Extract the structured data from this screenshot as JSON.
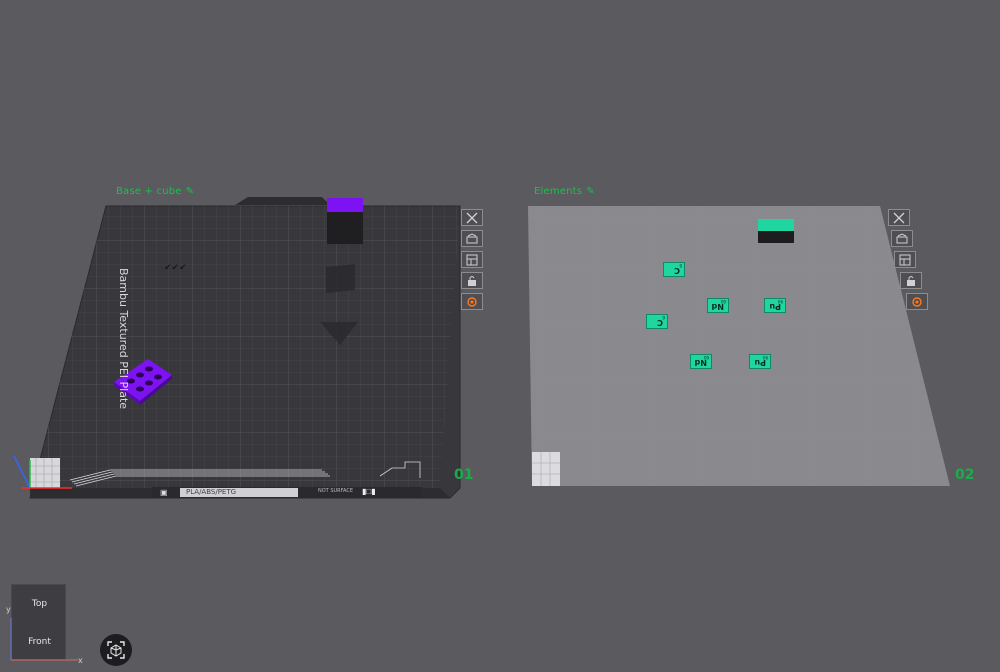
{
  "colors": {
    "background": "#5a5a5f",
    "accent_green": "#19c24a",
    "filament_purple": "#7d12f2",
    "filament_teal": "#1fd6a0"
  },
  "plates": [
    {
      "title": "Base + cube",
      "number": "01",
      "bed_label": "Bambu Textured PEI Plate",
      "filament_label": "PLA/ABS/PETG",
      "surface_label": "NOT SURFACE",
      "selected": true,
      "tools": [
        "close-icon",
        "auto-orient-icon",
        "arrange-icon",
        "lock-icon",
        "settings-icon"
      ]
    },
    {
      "title": "Elements",
      "number": "02",
      "selected": false,
      "tools": [
        "close-icon",
        "auto-orient-icon",
        "arrange-icon",
        "lock-icon",
        "settings-icon"
      ],
      "tiles": [
        {
          "symbol": "C",
          "number": "6"
        },
        {
          "symbol": "Nd",
          "number": "60"
        },
        {
          "symbol": "Pu",
          "number": "94"
        },
        {
          "symbol": "C",
          "number": "6"
        },
        {
          "symbol": "Nd",
          "number": "60"
        },
        {
          "symbol": "Pu",
          "number": "94"
        }
      ]
    }
  ],
  "view_cube": {
    "top_label": "Top",
    "front_label": "Front",
    "x_axis": "x",
    "y_axis": "y"
  },
  "fit_button": {
    "icon": "fit-view-icon"
  }
}
